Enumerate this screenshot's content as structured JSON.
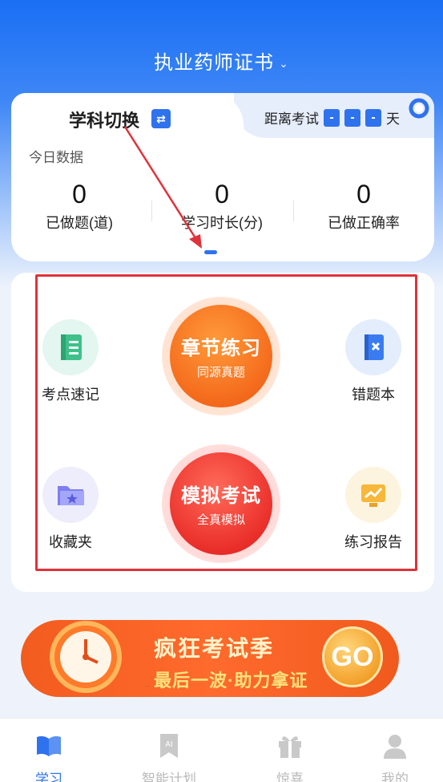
{
  "header": {
    "title": "执业药师证书"
  },
  "subject": {
    "title": "学科切换"
  },
  "countdown": {
    "label": "距离考试",
    "digits": [
      "-",
      "-",
      "-"
    ],
    "unit": "天"
  },
  "today": {
    "label": "今日数据",
    "stats": [
      {
        "value": "0",
        "label": "已做题(道)"
      },
      {
        "value": "0",
        "label": "学习时长(分)"
      },
      {
        "value": "0",
        "label": "已做正确率"
      }
    ]
  },
  "features": {
    "chapter": {
      "title": "章节练习",
      "sub": "同源真题"
    },
    "mock": {
      "title": "模拟考试",
      "sub": "全真模拟"
    },
    "key_points": "考点速记",
    "wrong_book": "错题本",
    "favorites": "收藏夹",
    "report": "练习报告"
  },
  "banner": {
    "title": "疯狂考试季",
    "sub": "最后一波·助力拿证",
    "go": "GO"
  },
  "nav": {
    "items": [
      {
        "label": "学习"
      },
      {
        "label": "智能计划"
      },
      {
        "label": "惊喜"
      },
      {
        "label": "我的"
      }
    ]
  },
  "colors": {
    "primary": "#2f72ee",
    "orange": "#ff6a2d",
    "red": "#e0323a"
  }
}
